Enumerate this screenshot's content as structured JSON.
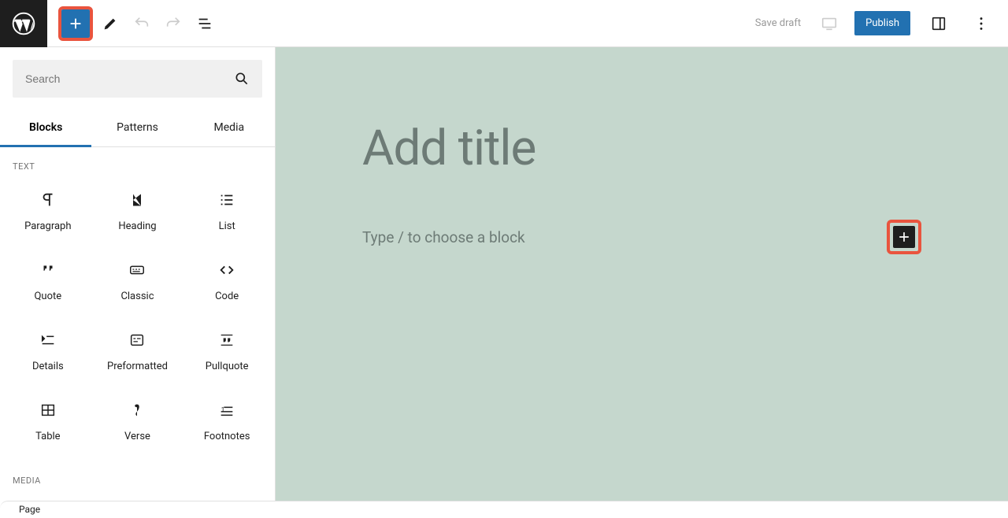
{
  "toolbar": {
    "save_draft": "Save draft",
    "publish": "Publish"
  },
  "inserter": {
    "search_placeholder": "Search",
    "tabs": {
      "blocks": "Blocks",
      "patterns": "Patterns",
      "media": "Media"
    },
    "sections": {
      "text": "TEXT",
      "media": "MEDIA"
    },
    "blocks": {
      "paragraph": "Paragraph",
      "heading": "Heading",
      "list": "List",
      "quote": "Quote",
      "classic": "Classic",
      "code": "Code",
      "details": "Details",
      "preformatted": "Preformatted",
      "pullquote": "Pullquote",
      "table": "Table",
      "verse": "Verse",
      "footnotes": "Footnotes"
    }
  },
  "editor": {
    "title_placeholder": "Add title",
    "body_placeholder": "Type / to choose a block"
  },
  "footer": {
    "breadcrumb": "Page"
  }
}
